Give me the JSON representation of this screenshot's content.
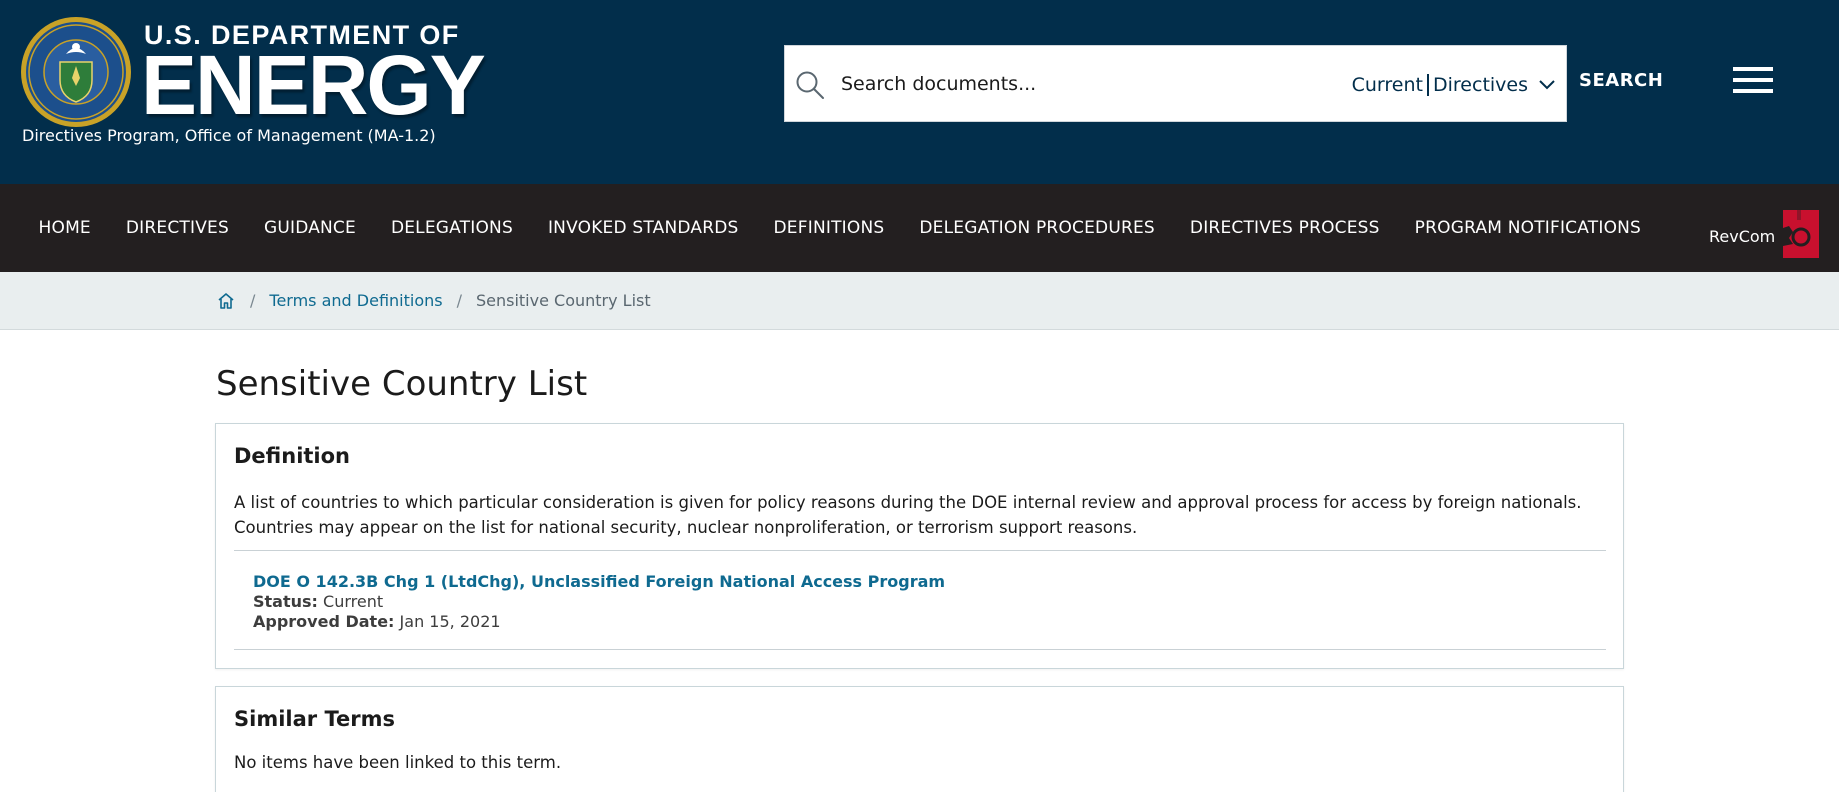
{
  "header": {
    "brand_top": "U.S. DEPARTMENT OF",
    "brand_main": "ENERGY",
    "brand_sub": "Directives Program, Office of Management (MA-1.2)",
    "seal_icon": "doe-seal-icon",
    "search": {
      "placeholder": "Search documents...",
      "scope_current": "Current",
      "scope_directives": "Directives",
      "button_label": "SEARCH"
    },
    "colors": {
      "background": "#022e4b"
    }
  },
  "nav": {
    "items": [
      {
        "label": "HOME"
      },
      {
        "label": "DIRECTIVES"
      },
      {
        "label": "GUIDANCE"
      },
      {
        "label": "DELEGATIONS"
      },
      {
        "label": "INVOKED STANDARDS"
      },
      {
        "label": "DEFINITIONS"
      },
      {
        "label": "DELEGATION PROCEDURES"
      },
      {
        "label": "DIRECTIVES PROCESS"
      },
      {
        "label": "PROGRAM NOTIFICATIONS"
      }
    ],
    "revcom_label": "RevCom",
    "colors": {
      "background": "#231f20",
      "revcom_accent": "#c8102e"
    }
  },
  "breadcrumb": {
    "home_icon": "home-icon",
    "separator": "/",
    "link": "Terms and Definitions",
    "current": "Sensitive Country List"
  },
  "main": {
    "title": "Sensitive Country List",
    "definition": {
      "heading": "Definition",
      "text": "A list of countries to which particular consideration is given for policy reasons during the DOE internal review and approval process for access by foreign nationals. Countries may appear on the list for national security, nuclear nonproliferation, or terrorism support reasons.",
      "reference": {
        "title": "DOE O 142.3B Chg 1 (LtdChg), Unclassified Foreign National Access Program",
        "status_label": "Status:",
        "status_value": "Current",
        "date_label": "Approved Date:",
        "date_value": "Jan 15, 2021"
      }
    },
    "similar_terms": {
      "heading": "Similar Terms",
      "empty_text": "No items have been linked to this term."
    },
    "colors": {
      "link": "#0f6a90",
      "card_border": "#c9d6da"
    }
  }
}
